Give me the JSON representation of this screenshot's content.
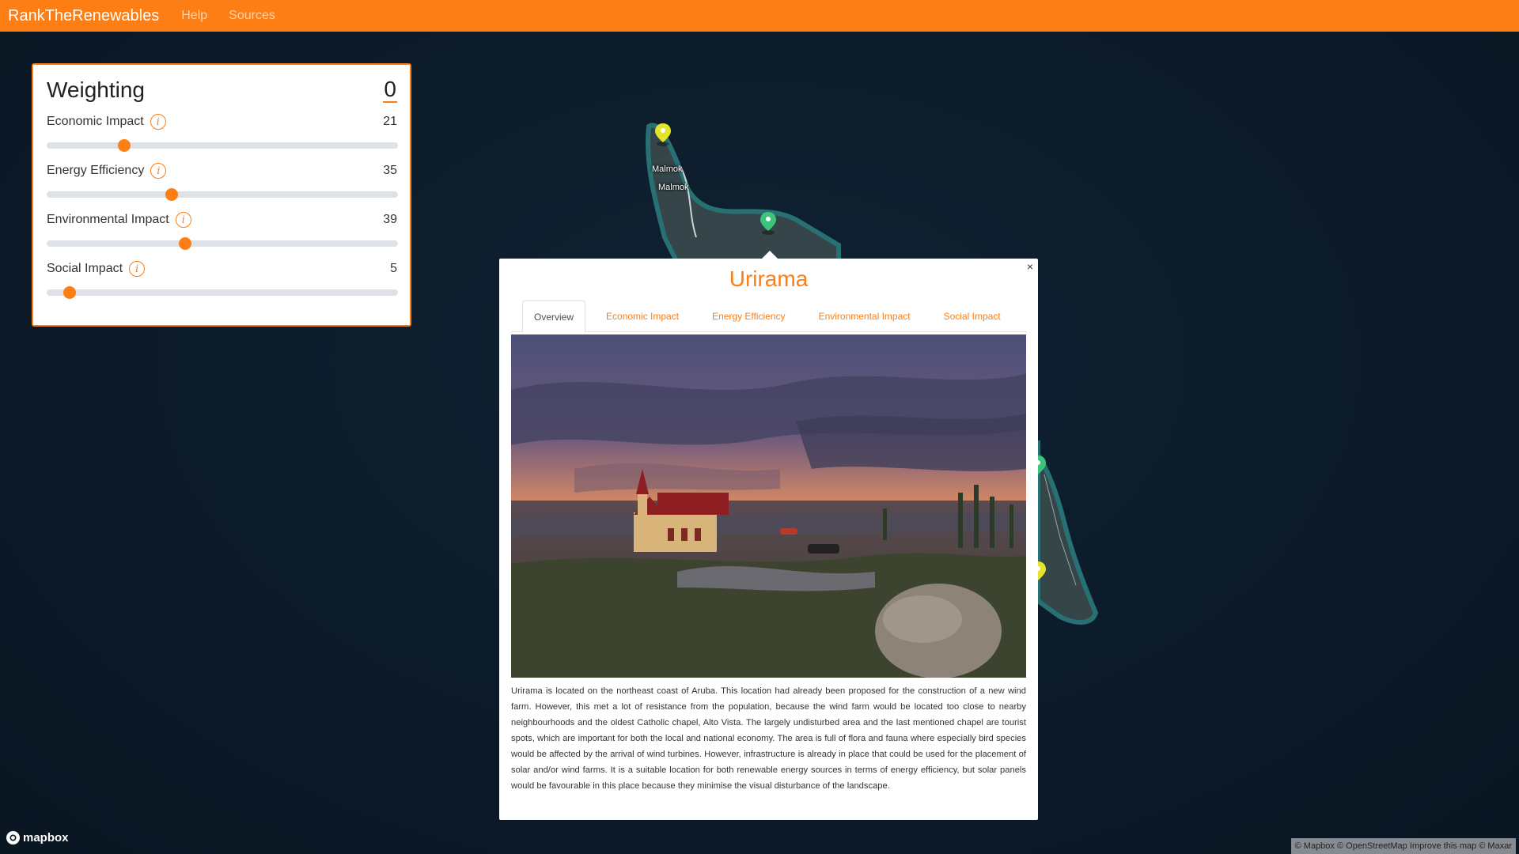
{
  "navbar": {
    "brand": "RankTheRenewables",
    "links": [
      "Help",
      "Sources"
    ]
  },
  "weighting": {
    "title": "Weighting",
    "total": "0",
    "items": [
      {
        "label": "Economic Impact",
        "value": "21",
        "fraction": 0.21
      },
      {
        "label": "Energy Efficiency",
        "value": "35",
        "fraction": 0.35
      },
      {
        "label": "Environmental Impact",
        "value": "39",
        "fraction": 0.39
      },
      {
        "label": "Social Impact",
        "value": "5",
        "fraction": 0.05
      }
    ]
  },
  "map": {
    "labels": [
      "Malmok",
      "Malmok"
    ],
    "markers": [
      {
        "color": "#e4e52a"
      },
      {
        "color": "#3cc47a"
      },
      {
        "color": "#3cc47a"
      },
      {
        "color": "#e4e52a"
      }
    ],
    "logo_text": "mapbox",
    "attribution": "© Mapbox © OpenStreetMap Improve this map © Maxar"
  },
  "popup": {
    "close": "×",
    "title": "Urirama",
    "tabs": [
      "Overview",
      "Economic Impact",
      "Energy Efficiency",
      "Environmental Impact",
      "Social Impact"
    ],
    "active_tab": "Overview",
    "description": "Urirama is located on the northeast coast of Aruba. This location had already been proposed for the construction of a new wind farm. However, this met a lot of resistance from the population, because the wind farm would be located too close to nearby neighbourhoods and the oldest Catholic chapel, Alto Vista. The largely undisturbed area and the last mentioned chapel are tourist spots, which are important for both the local and national economy. The area is full of flora and fauna where especially bird species would be affected by the arrival of wind turbines. However, infrastructure is already in place that could be used for the placement of solar and/or wind farms. It is a suitable location for both renewable energy sources in terms of energy efficiency, but solar panels would be favourable in this place because they minimise the visual disturbance of the landscape."
  },
  "colors": {
    "accent": "#fd7e14",
    "map_bg": "#0d1a26"
  }
}
